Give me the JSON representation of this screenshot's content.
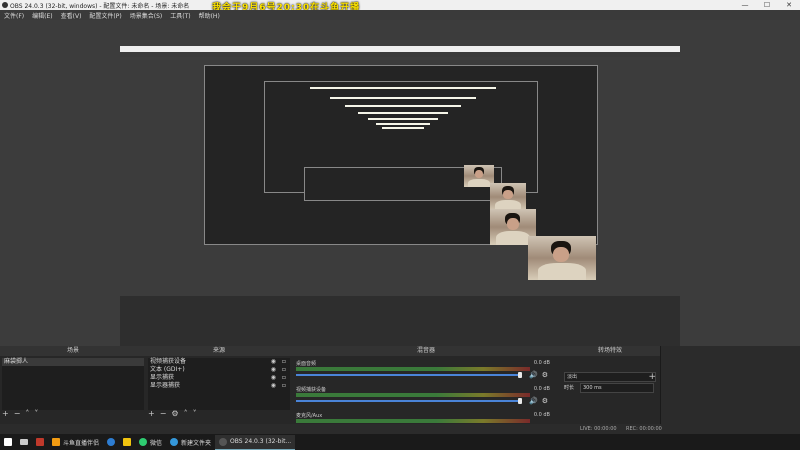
{
  "window": {
    "title": "OBS 24.0.3 (32-bit, windows) - 配置文件: 未命名 - 场景: 未命名",
    "icon": "obs-icon"
  },
  "overlay_text": "我会于9月6号20:30在斗鱼开播",
  "menu": [
    "文件(F)",
    "编辑(E)",
    "查看(V)",
    "配置文件(P)",
    "场景集合(S)",
    "工具(T)",
    "帮助(H)"
  ],
  "docks": {
    "scenes": {
      "title": "场景",
      "items": [
        "麻袋掷人"
      ]
    },
    "sources": {
      "title": "来源",
      "items": [
        "视频捕获设备",
        "文本 (GDI+)",
        "显示捕获",
        "显示器捕获"
      ]
    },
    "mixer": {
      "title": "混音器",
      "channels": [
        {
          "name": "桌面音频",
          "db": "0.0 dB"
        },
        {
          "name": "视频捕获设备",
          "db": "0.0 dB"
        },
        {
          "name": "麦克风/Aux",
          "db": "0.0 dB"
        }
      ]
    },
    "transitions": {
      "title": "转场特效",
      "selected": "淡出",
      "duration_label": "时长",
      "duration": "300 ms"
    }
  },
  "status": {
    "live": "LIVE: 00:00:00",
    "rec": "REC: 00:00:00"
  },
  "taskbar": {
    "items": [
      {
        "label": "",
        "icon": "windows-start-icon",
        "color": "#ffffff"
      },
      {
        "label": "",
        "icon": "task-view-icon",
        "color": "#cccccc"
      },
      {
        "label": "",
        "icon": "media-icon",
        "color": "#c0392b"
      },
      {
        "label": "斗鱼直播伴侣",
        "icon": "douyu-icon",
        "color": "#f39c12"
      },
      {
        "label": "",
        "icon": "edge-icon",
        "color": "#2d7dd2"
      },
      {
        "label": "",
        "icon": "file-explorer-icon",
        "color": "#f1c40f"
      },
      {
        "label": "微信",
        "icon": "wechat-icon",
        "color": "#2ecc71"
      },
      {
        "label": "新建文件夹",
        "icon": "folder-icon",
        "color": "#3498db"
      },
      {
        "label": "OBS 24.0.3 (32-bit...",
        "icon": "obs-icon",
        "color": "#555555"
      }
    ]
  }
}
